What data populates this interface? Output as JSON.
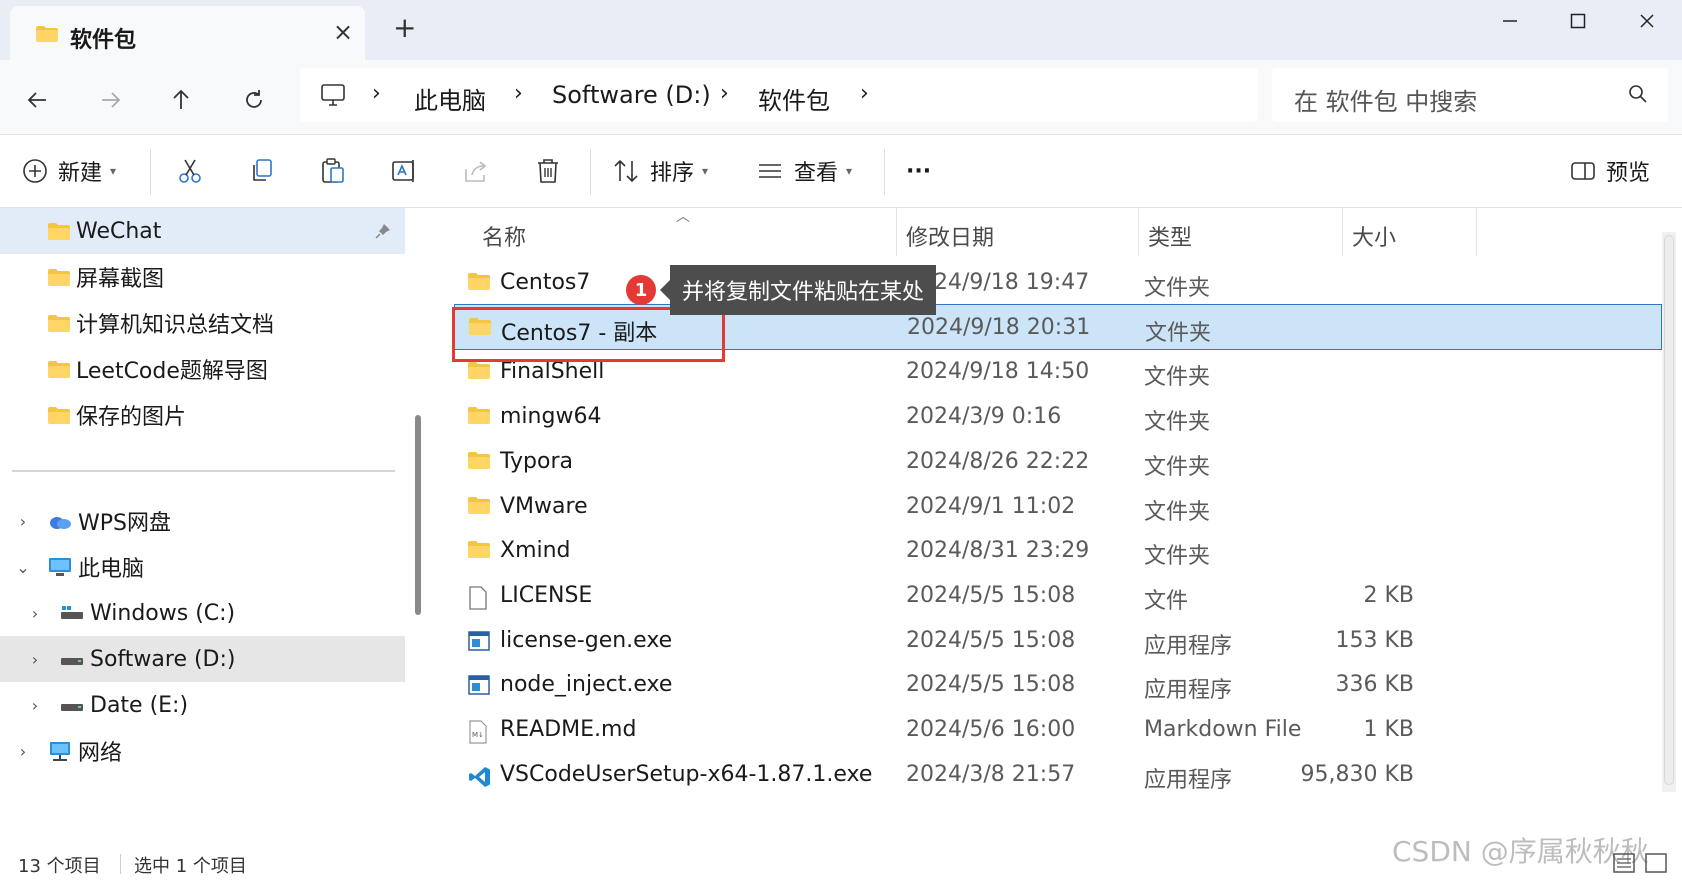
{
  "window": {
    "tab_title": "软件包",
    "tab_close": "×",
    "new_tab": "+"
  },
  "address": {
    "crumbs": [
      "此电脑",
      "Software (D:)",
      "软件包"
    ],
    "separator": "›",
    "search_placeholder": "在 软件包 中搜索"
  },
  "toolbar": {
    "new_label": "新建",
    "sort_label": "排序",
    "view_label": "查看",
    "more_label": "···",
    "preview_label": "预览"
  },
  "sidebar": {
    "quick_access": [
      {
        "label": "WeChat",
        "pinned": true
      },
      {
        "label": "屏幕截图"
      },
      {
        "label": "计算机知识总结文档"
      },
      {
        "label": "LeetCode题解导图"
      },
      {
        "label": "保存的图片"
      }
    ],
    "tree": [
      {
        "label": "WPS网盘",
        "icon": "cloud-icon"
      },
      {
        "label": "此电脑",
        "icon": "computer-icon"
      },
      {
        "label": "Windows  (C:)",
        "icon": "drive-icon"
      },
      {
        "label": "Software (D:)",
        "icon": "drive-icon"
      },
      {
        "label": "Date (E:)",
        "icon": "drive-icon"
      },
      {
        "label": "网络",
        "icon": "network-icon"
      }
    ]
  },
  "columns": {
    "name": "名称",
    "date": "修改日期",
    "type": "类型",
    "size": "大小"
  },
  "files": [
    {
      "name": "Centos7",
      "date": "2024/9/18 19:47",
      "type": "文件夹",
      "size": "",
      "icon": "folder-icon"
    },
    {
      "name": "Centos7 - 副本",
      "date": "2024/9/18 20:31",
      "type": "文件夹",
      "size": "",
      "icon": "folder-icon"
    },
    {
      "name": "FinalShell",
      "date": "2024/9/18 14:50",
      "type": "文件夹",
      "size": "",
      "icon": "folder-icon"
    },
    {
      "name": "mingw64",
      "date": "2024/3/9 0:16",
      "type": "文件夹",
      "size": "",
      "icon": "folder-icon"
    },
    {
      "name": "Typora",
      "date": "2024/8/26 22:22",
      "type": "文件夹",
      "size": "",
      "icon": "folder-icon"
    },
    {
      "name": "VMware",
      "date": "2024/9/1 11:02",
      "type": "文件夹",
      "size": "",
      "icon": "folder-icon"
    },
    {
      "name": "Xmind",
      "date": "2024/8/31 23:29",
      "type": "文件夹",
      "size": "",
      "icon": "folder-icon"
    },
    {
      "name": "LICENSE",
      "date": "2024/5/5 15:08",
      "type": "文件",
      "size": "2 KB",
      "icon": "file-icon"
    },
    {
      "name": "license-gen.exe",
      "date": "2024/5/5 15:08",
      "type": "应用程序",
      "size": "153 KB",
      "icon": "exe-icon"
    },
    {
      "name": "node_inject.exe",
      "date": "2024/5/5 15:08",
      "type": "应用程序",
      "size": "336 KB",
      "icon": "exe-icon"
    },
    {
      "name": "README.md",
      "date": "2024/5/6 16:00",
      "type": "Markdown File",
      "size": "1 KB",
      "icon": "markdown-icon"
    },
    {
      "name": "VSCodeUserSetup-x64-1.87.1.exe",
      "date": "2024/3/8 21:57",
      "type": "应用程序",
      "size": "95,830 KB",
      "icon": "vscode-icon"
    }
  ],
  "annotation": {
    "badge": "1",
    "tooltip": "并将复制文件粘贴在某处"
  },
  "status": {
    "count": "13 个项目",
    "selected": "选中 1 个项目"
  },
  "watermark": "CSDN @序属秋秋秋",
  "colors": {
    "accent": "#2f76c7",
    "selection": "#cce4f7",
    "annotation_red": "#e53935",
    "folder": "#f4c542"
  }
}
